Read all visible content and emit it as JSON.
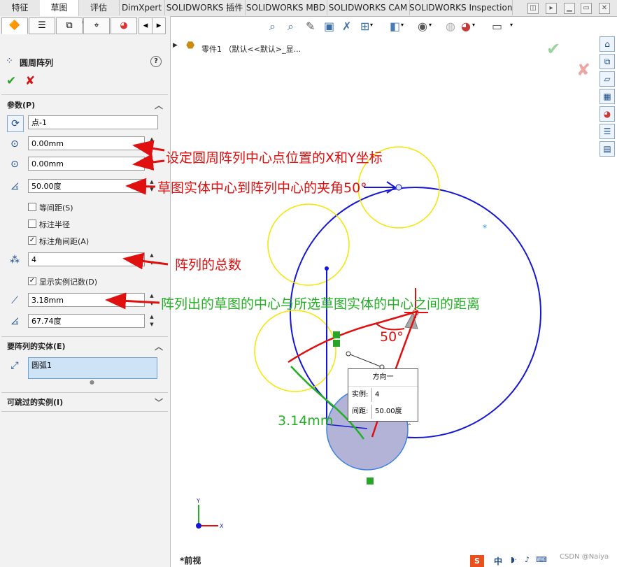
{
  "tabs": [
    "特征",
    "草图",
    "评估",
    "DimXpert",
    "SOLIDWORKS 插件",
    "SOLIDWORKS MBD",
    "SOLIDWORKS CAM",
    "SOLIDWORKS Inspection"
  ],
  "active_tab": "草图",
  "panel": {
    "title": "圆周阵列",
    "params_section": "参数(P)",
    "center_point": "点-1",
    "x_value": "0.00mm",
    "y_value": "0.00mm",
    "angle_value": "50.00度",
    "checkboxes": [
      {
        "label": "等间距(S)",
        "checked": false
      },
      {
        "label": "标注半径",
        "checked": false
      },
      {
        "label": "标注角间距(A)",
        "checked": true
      }
    ],
    "count_value": "4",
    "show_count_label": "显示实例记数(D)",
    "show_count_checked": true,
    "radius_value": "3.18mm",
    "arc_angle_value": "67.74度",
    "entities_section": "要阵列的实体(E)",
    "entities": [
      "圆弧1"
    ],
    "skip_section": "可跳过的实例(I)"
  },
  "tree": {
    "label": "零件1 （默认<<默认>_显..."
  },
  "annotations": {
    "xy": "设定圆周阵列中心点位置的X和Y坐标",
    "angle": "草图实体中心到阵列中心的夹角50°",
    "count": "阵列的总数",
    "distance": "阵列出的草图的中心与所选草图实体的中心之间的距离",
    "angle_label": "50°",
    "length_label": "3.14mm"
  },
  "callout": {
    "title": "方向一",
    "instance_label": "实例:",
    "instance_value": "4",
    "spacing_label": "间距:",
    "spacing_value": "50.00度"
  },
  "view_label": "*前视",
  "watermark": "CSDN @Naiya",
  "ime_label": "中",
  "colors": {
    "accent_blue": "#1616d8",
    "yellow_circle": "#f3e600",
    "annotation_red": "#e01010",
    "annotation_green": "#24b024"
  }
}
